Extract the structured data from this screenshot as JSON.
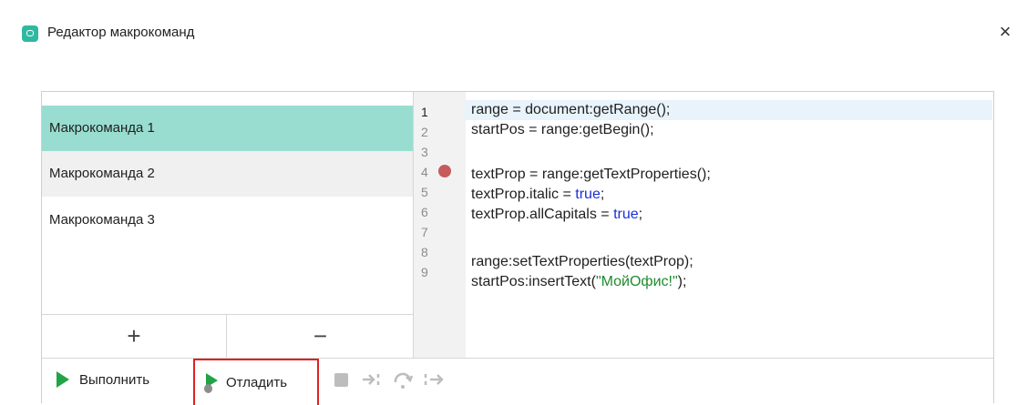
{
  "window": {
    "title": "Редактор макрокоманд",
    "close_glyph": "×",
    "app_icon": "myoffice-app-icon"
  },
  "macros": {
    "items": [
      {
        "label": "Макрокоманда 1",
        "state": "selected"
      },
      {
        "label": "Макрокоманда 2",
        "state": "hover"
      },
      {
        "label": "Макрокоманда 3",
        "state": "normal"
      }
    ],
    "add_label": "+",
    "remove_label": "−"
  },
  "editor": {
    "line_numbers": [
      "1",
      "2",
      "3",
      "4",
      "5",
      "6",
      "7",
      "8",
      "9"
    ],
    "breakpoint_line": 4,
    "current_line": 1,
    "lines": [
      "range = document:getRange();",
      "startPos = range:getBegin();",
      "",
      "textProp = range:getTextProperties();",
      "textProp.italic = true;",
      "textProp.allCapitals = true;",
      "",
      "range:setTextProperties(textProp);",
      "startPos:insertText(\"МойОфис!\");"
    ],
    "colors": {
      "keyword": "#1a2fd6",
      "string": "#1f8a2e",
      "breakpoint": "#c75a5a",
      "current_line": "#e8f3fc"
    }
  },
  "toolbar": {
    "run_label": "Выполнить",
    "debug_label": "Отладить",
    "icons": [
      "play-icon",
      "debug-play-icon",
      "stop-icon",
      "step-into-icon",
      "step-over-icon",
      "step-out-icon"
    ]
  },
  "colors": {
    "accent": "#99ddd1",
    "run_green": "#22a446",
    "highlight_border": "#e02020"
  }
}
